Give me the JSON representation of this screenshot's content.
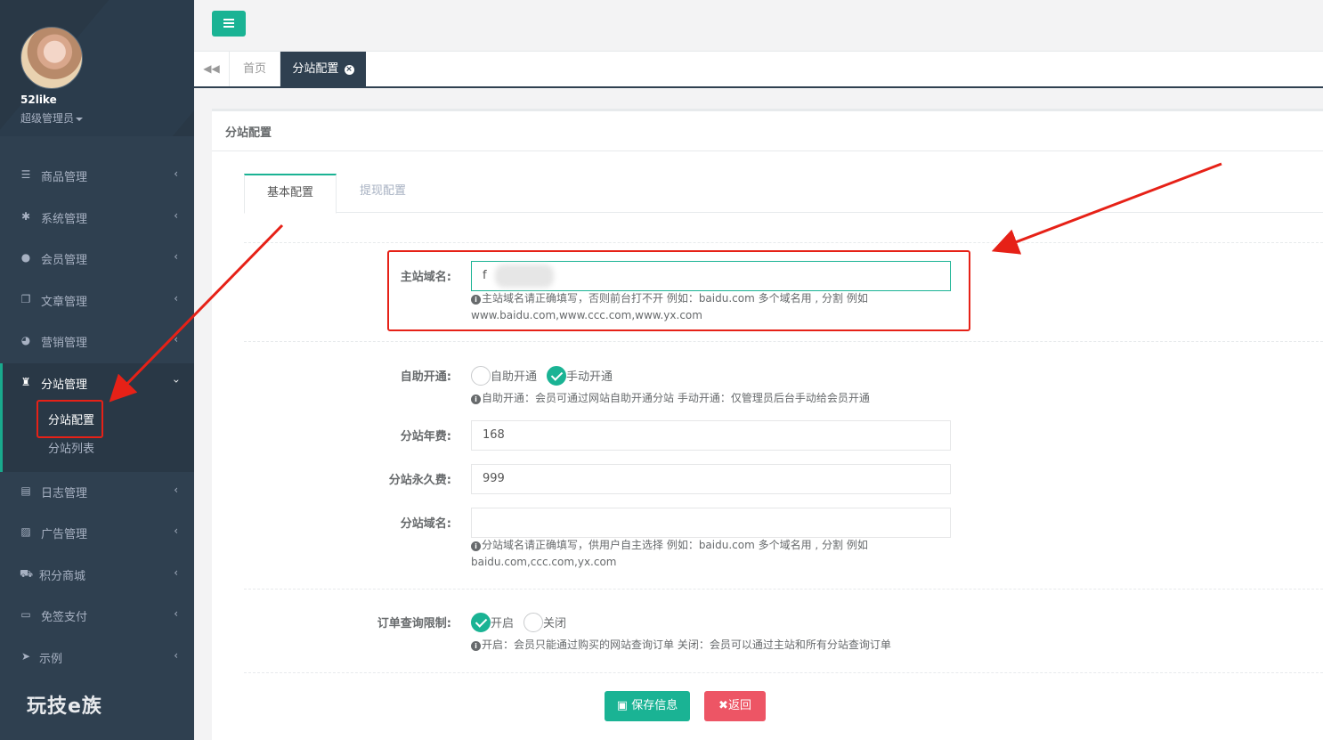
{
  "sidebar": {
    "user_name": "52like",
    "user_role": "超级管理员",
    "menu": [
      {
        "label": "商品管理",
        "icon": "bars-icon"
      },
      {
        "label": "系统管理",
        "icon": "gear-icon"
      },
      {
        "label": "会员管理",
        "icon": "users-icon"
      },
      {
        "label": "文章管理",
        "icon": "copy-icon"
      },
      {
        "label": "营销管理",
        "icon": "pie-chart-icon"
      },
      {
        "label": "分站管理",
        "icon": "trophy-icon"
      },
      {
        "label": "日志管理",
        "icon": "list-icon"
      },
      {
        "label": "广告管理",
        "icon": "image-icon"
      },
      {
        "label": "积分商城",
        "icon": "cart-icon"
      },
      {
        "label": "免签支付",
        "icon": "credit-card-icon"
      },
      {
        "label": "示例",
        "icon": "send-icon"
      }
    ],
    "submenu": [
      "分站配置",
      "分站列表"
    ],
    "logo_text": "玩技e族"
  },
  "tabs": {
    "home": "首页",
    "current": "分站配置"
  },
  "panel": {
    "title": "分站配置",
    "tab_basic": "基本配置",
    "tab_withdraw": "提现配置"
  },
  "form": {
    "main_domain": {
      "label": "主站域名:",
      "value": "f",
      "help": "主站域名请正确填写，否则前台打不开 例如：baidu.com 多个域名用 , 分割 例如 www.baidu.com,www.ccc.com,www.yx.com"
    },
    "self_open": {
      "label": "自助开通:",
      "options": [
        "自助开通",
        "手动开通"
      ],
      "selected": "手动开通",
      "help": "自助开通：会员可通过网站自助开通分站 手动开通：仅管理员后台手动给会员开通"
    },
    "annual_fee": {
      "label": "分站年费:",
      "value": "168"
    },
    "permanent_fee": {
      "label": "分站永久费:",
      "value": "999"
    },
    "sub_domain": {
      "label": "分站域名:",
      "value": "",
      "help": "分站域名请正确填写，供用户自主选择 例如：baidu.com 多个域名用 , 分割 例如 baidu.com,ccc.com,yx.com"
    },
    "order_limit": {
      "label": "订单查询限制:",
      "options": [
        "开启",
        "关闭"
      ],
      "selected": "开启",
      "help": "开启：会员只能通过购买的网站查询订单 关闭：会员可以通过主站和所有分站查询订单"
    }
  },
  "buttons": {
    "save": "保存信息",
    "back": "返回"
  },
  "colors": {
    "sidebar_bg": "#2f4050",
    "accent": "#1ab394",
    "danger": "#ed5565",
    "annotation": "#e62117"
  }
}
